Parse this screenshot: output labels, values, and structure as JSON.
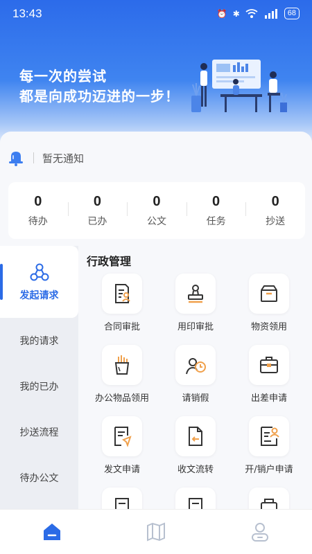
{
  "status": {
    "time": "13:43",
    "battery": "68"
  },
  "banner": {
    "slogan_line1": "每一次的尝试",
    "slogan_line2": "都是向成功迈进的一步！"
  },
  "notice": {
    "text": "暂无通知"
  },
  "stats": [
    {
      "value": "0",
      "label": "待办"
    },
    {
      "value": "0",
      "label": "已办"
    },
    {
      "value": "0",
      "label": "公文"
    },
    {
      "value": "0",
      "label": "任务"
    },
    {
      "value": "0",
      "label": "抄送"
    }
  ],
  "side_menu": [
    {
      "label": "发起请求",
      "active": true
    },
    {
      "label": "我的请求"
    },
    {
      "label": "我的已办"
    },
    {
      "label": "抄送流程"
    },
    {
      "label": "待办公文"
    }
  ],
  "section": {
    "title": "行政管理"
  },
  "apps": [
    {
      "label": "合同审批",
      "icon": "contract-icon"
    },
    {
      "label": "用印审批",
      "icon": "seal-icon"
    },
    {
      "label": "物资领用",
      "icon": "box-icon"
    },
    {
      "label": "办公物品领用",
      "icon": "pen-holder-icon"
    },
    {
      "label": "请销假",
      "icon": "leave-clock-icon"
    },
    {
      "label": "出差申请",
      "icon": "briefcase-icon"
    },
    {
      "label": "发文申请",
      "icon": "send-doc-icon"
    },
    {
      "label": "收文流转",
      "icon": "receive-doc-icon"
    },
    {
      "label": "开/销户申请",
      "icon": "account-doc-icon"
    }
  ],
  "colors": {
    "primary": "#2b6be6",
    "accent": "#f0a04b"
  }
}
